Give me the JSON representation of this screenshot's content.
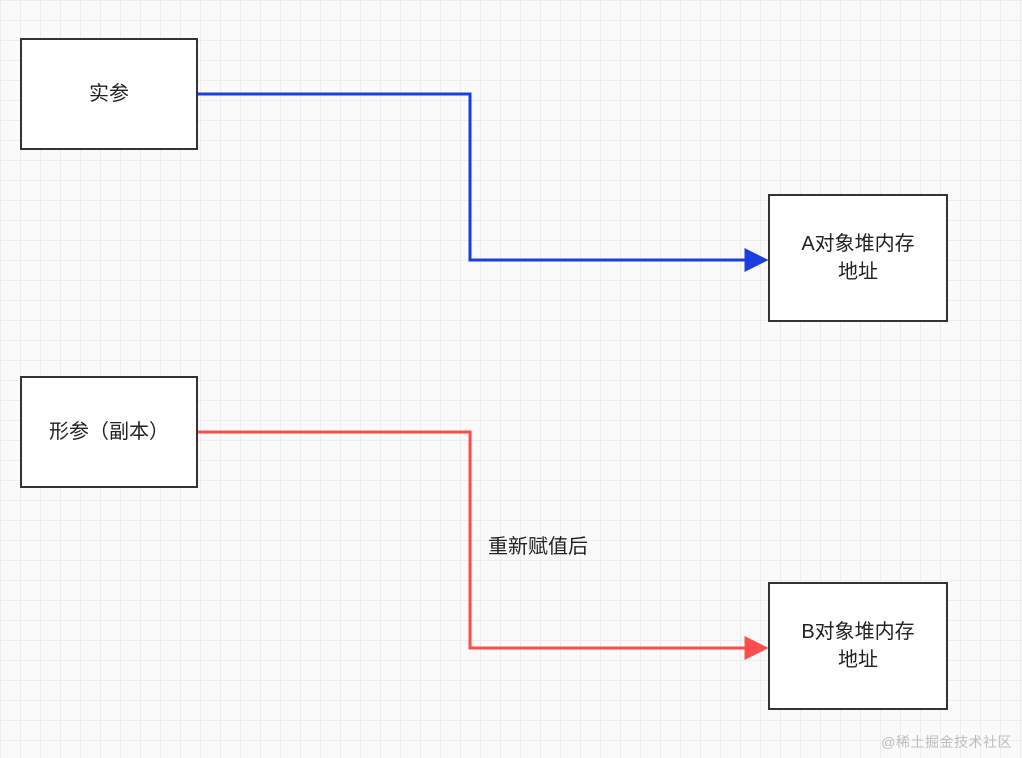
{
  "diagram": {
    "nodes": {
      "arg_actual": {
        "label": "实参"
      },
      "arg_formal": {
        "label": "形参（副本）"
      },
      "heap_a_line1": "A对象堆内存",
      "heap_a_line2": "地址",
      "heap_b_line1": "B对象堆内存",
      "heap_b_line2": "地址"
    },
    "edges": {
      "actual_to_a": {
        "color": "#1a3fe0"
      },
      "formal_to_b": {
        "color": "#ff4d4d",
        "label": "重新赋值后"
      }
    }
  },
  "watermark": "@稀土掘金技术社区"
}
